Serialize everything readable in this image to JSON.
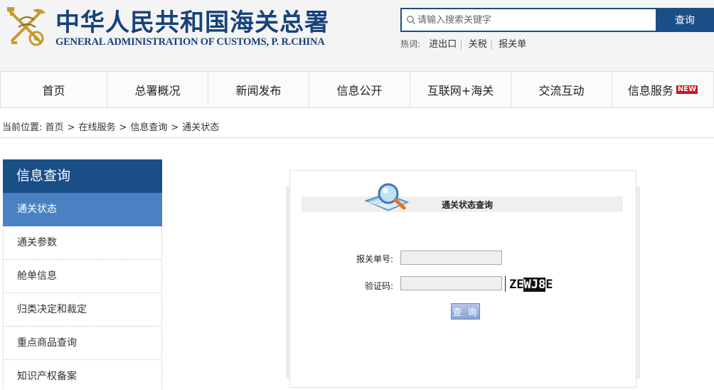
{
  "header": {
    "title_cn": "中华人民共和国海关总署",
    "title_en": "GENERAL ADMINISTRATION OF CUSTOMS, P. R.CHINA",
    "search_placeholder": "请输入搜索关键字",
    "search_button": "查询",
    "hot_label": "热词:",
    "hot_words": [
      "进出口",
      "关税",
      "报关单"
    ]
  },
  "nav": {
    "items": [
      "首页",
      "总署概况",
      "新闻发布",
      "信息公开",
      "互联网+海关",
      "交流互动",
      "信息服务"
    ],
    "new_badge": "NEW"
  },
  "breadcrumb": {
    "prefix": "当前位置:",
    "items": [
      "首页",
      "在线服务",
      "信息查询",
      "通关状态"
    ],
    "separator": ">"
  },
  "sidebar": {
    "title": "信息查询",
    "items": [
      "通关状态",
      "通关参数",
      "舱单信息",
      "归类决定和裁定",
      "重点商品查询",
      "知识产权备案"
    ],
    "active_index": 0
  },
  "query_form": {
    "title": "通关状态查询",
    "declaration_label": "报关单号:",
    "declaration_value": "",
    "captcha_label": "验证码:",
    "captcha_value": "",
    "captcha_text_plain_1": "ZE",
    "captcha_text_inverted": "WJ8",
    "captcha_text_plain_2": "E",
    "submit_label": "查 询"
  },
  "colors": {
    "brand_blue": "#1a4e86",
    "active_blue": "#4a81c3",
    "new_red": "#c8161d"
  }
}
